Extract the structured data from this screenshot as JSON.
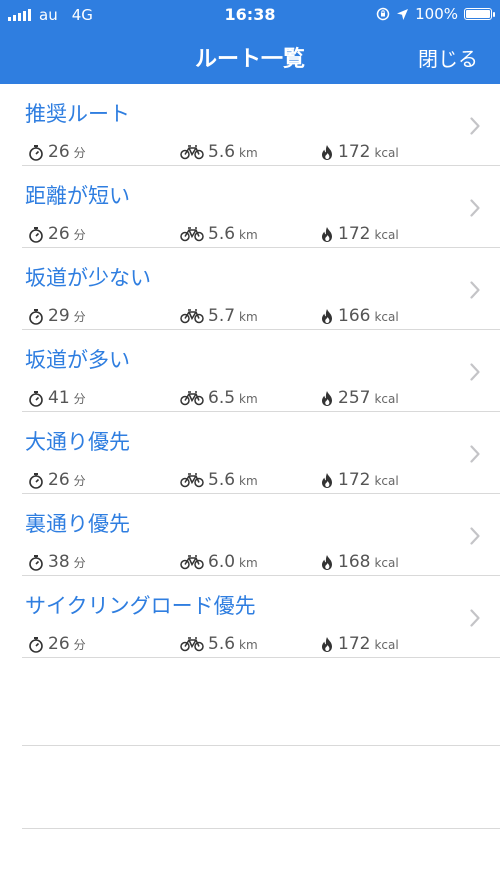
{
  "status_bar": {
    "carrier": "au",
    "network": "4G",
    "time": "16:38",
    "battery": "100%"
  },
  "header": {
    "title": "ルート一覧",
    "close_label": "閉じる"
  },
  "units": {
    "time": "分",
    "distance": "km",
    "energy": "kcal"
  },
  "routes": [
    {
      "name": "推奨ルート",
      "minutes": "26",
      "distance": "5.6",
      "kcal": "172"
    },
    {
      "name": "距離が短い",
      "minutes": "26",
      "distance": "5.6",
      "kcal": "172"
    },
    {
      "name": "坂道が少ない",
      "minutes": "29",
      "distance": "5.7",
      "kcal": "166"
    },
    {
      "name": "坂道が多い",
      "minutes": "41",
      "distance": "6.5",
      "kcal": "257"
    },
    {
      "name": "大通り優先",
      "minutes": "26",
      "distance": "5.6",
      "kcal": "172"
    },
    {
      "name": "裏通り優先",
      "minutes": "38",
      "distance": "6.0",
      "kcal": "168"
    },
    {
      "name": "サイクリングロード優先",
      "minutes": "26",
      "distance": "5.6",
      "kcal": "172"
    }
  ],
  "icons": {
    "time": "stopwatch-icon",
    "distance": "bicycle-icon",
    "energy": "flame-icon",
    "disclosure": "chevron-right-icon"
  },
  "colors": {
    "brand": "#2f7ee0",
    "meta_text": "#555555",
    "separator": "#d9d9d9"
  }
}
